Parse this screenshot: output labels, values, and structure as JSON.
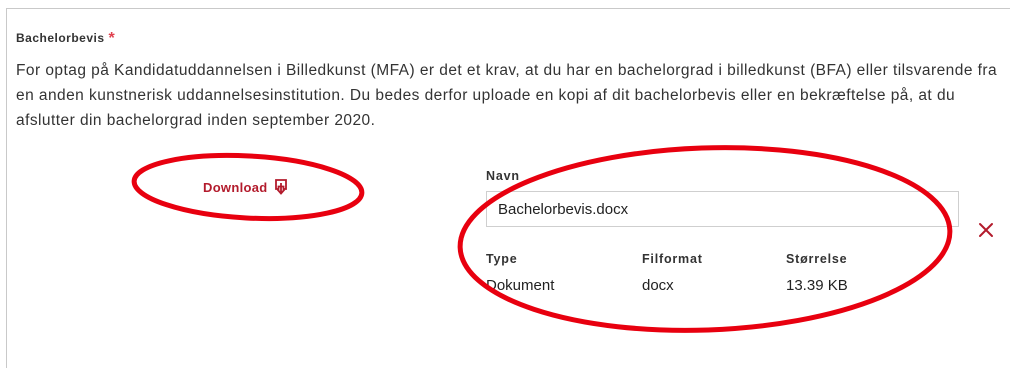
{
  "field": {
    "title": "Bachelorbevis",
    "required_mark": "*",
    "description": "For optag på Kandidatuddannelsen i Billedkunst (MFA) er det et krav, at du har en bachelorgrad i billedkunst (BFA) eller tilsvarende fra en anden kunstnerisk uddannelsesinstitution. Du bedes derfor uploade en kopi af dit bachelorbevis eller en bekræftelse på, at du afslutter din bachelorgrad inden september 2020."
  },
  "download": {
    "label": "Download",
    "icon": "download-icon"
  },
  "file": {
    "name_label": "Navn",
    "name_value": "Bachelorbevis.docx",
    "type_label": "Type",
    "type_value": "Dokument",
    "format_label": "Filformat",
    "format_value": "docx",
    "size_label": "Størrelse",
    "size_value": "13.39 KB",
    "remove_icon": "close-icon"
  },
  "colors": {
    "accent": "#b31b2c",
    "required": "#e0404e",
    "annotation": "#e8000f"
  }
}
